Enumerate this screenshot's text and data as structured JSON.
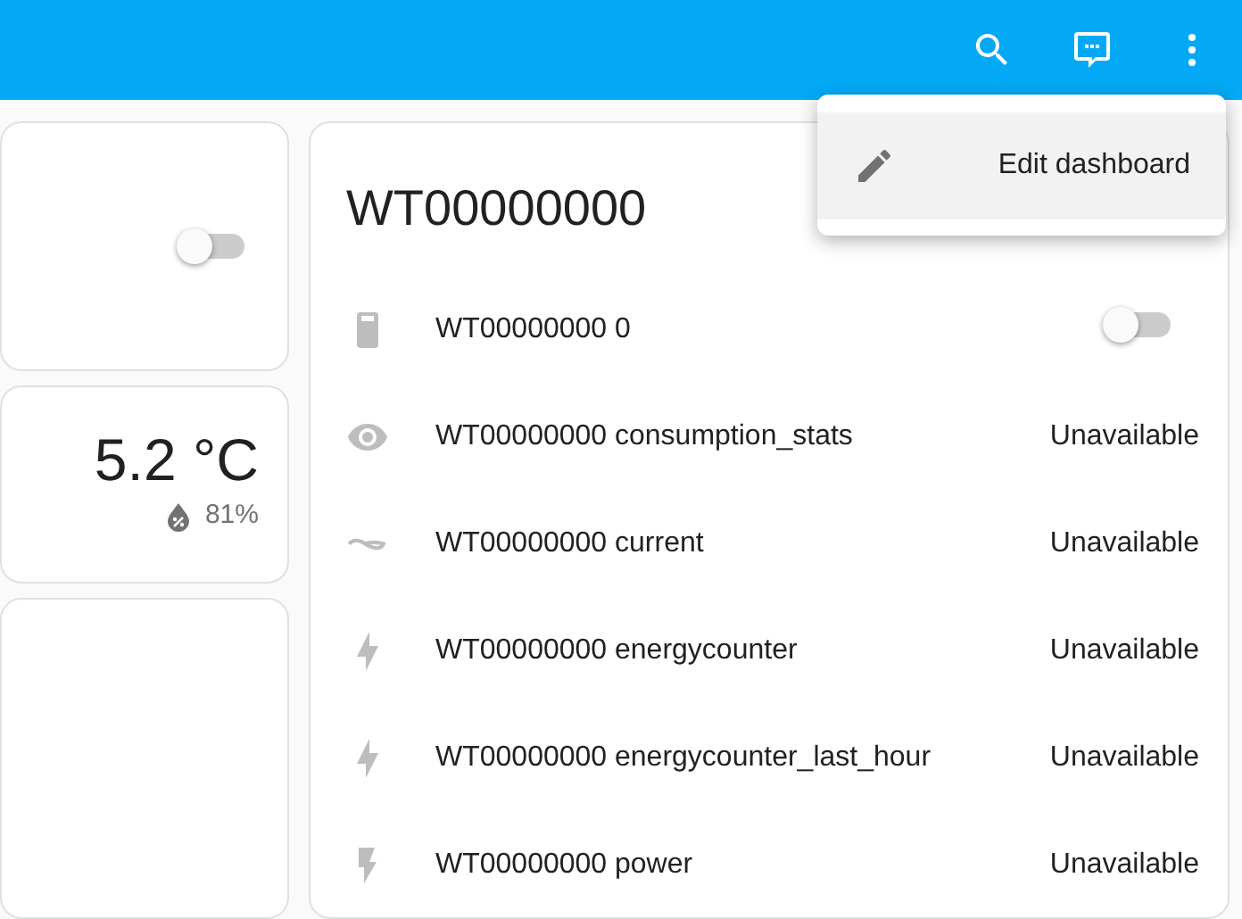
{
  "left_cards": [
    {
      "kind": "switch",
      "on": false
    },
    {
      "kind": "climate",
      "temperature": "5.2 °C",
      "humidity": "81%"
    },
    {
      "kind": "empty"
    }
  ],
  "entities_card": {
    "title": "WT00000000",
    "rows": [
      {
        "kind": "switch",
        "name": "WT00000000 0",
        "on": false
      },
      {
        "kind": "sensor",
        "name": "WT00000000 consumption_stats",
        "state": "Unavailable"
      },
      {
        "kind": "sensor",
        "name": "WT00000000 current",
        "state": "Unavailable"
      },
      {
        "kind": "sensor",
        "name": "WT00000000 energycounter",
        "state": "Unavailable"
      },
      {
        "kind": "sensor",
        "name": "WT00000000 energycounter_last_hour",
        "state": "Unavailable"
      },
      {
        "kind": "sensor",
        "name": "WT00000000 power",
        "state": "Unavailable"
      }
    ]
  },
  "menu": {
    "items": [
      {
        "label": "Edit dashboard",
        "selected": true
      }
    ]
  }
}
